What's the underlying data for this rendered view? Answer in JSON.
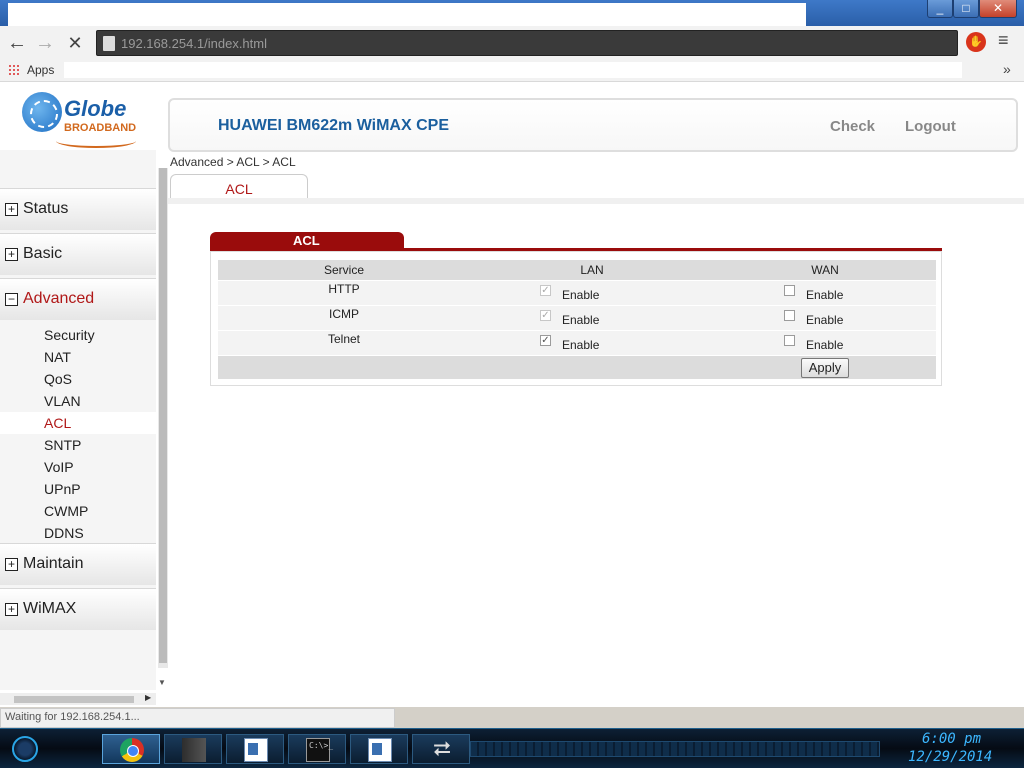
{
  "browser": {
    "url": "192.168.254.1/index.html",
    "bookmarks_apps_label": "Apps",
    "bookmarks_more": "»",
    "status_text": "Waiting for 192.168.254.1..."
  },
  "header": {
    "logo_name": "Globe",
    "logo_sub": "BROADBAND",
    "title": "HUAWEI BM622m WiMAX CPE",
    "check_label": "Check",
    "logout_label": "Logout"
  },
  "sidebar": {
    "top_items": [
      {
        "label": "Status",
        "sign": "+"
      },
      {
        "label": "Basic",
        "sign": "+"
      },
      {
        "label": "Advanced",
        "sign": "−"
      },
      {
        "label": "Maintain",
        "sign": "+"
      },
      {
        "label": "WiMAX",
        "sign": "+"
      }
    ],
    "advanced_items": [
      "Security",
      "NAT",
      "QoS",
      "VLAN",
      "ACL",
      "SNTP",
      "VoIP",
      "UPnP",
      "CWMP",
      "DDNS"
    ]
  },
  "content": {
    "breadcrumb": "Advanced > ACL > ACL",
    "tab_label": "ACL",
    "panel_title": "ACL",
    "columns": [
      "Service",
      "LAN",
      "WAN"
    ],
    "rows": [
      {
        "service": "HTTP",
        "lan_checked": true,
        "lan_disabled": true,
        "lan_label": "Enable",
        "wan_checked": false,
        "wan_label": "Enable"
      },
      {
        "service": "ICMP",
        "lan_checked": true,
        "lan_disabled": true,
        "lan_label": "Enable",
        "wan_checked": false,
        "wan_label": "Enable"
      },
      {
        "service": "Telnet",
        "lan_checked": true,
        "lan_disabled": false,
        "lan_label": "Enable",
        "wan_checked": false,
        "wan_label": "Enable"
      }
    ],
    "apply_label": "Apply"
  },
  "taskbar": {
    "time": "6:00 pm",
    "date": "12/29/2014",
    "cmd_text": "C:\\>_"
  }
}
